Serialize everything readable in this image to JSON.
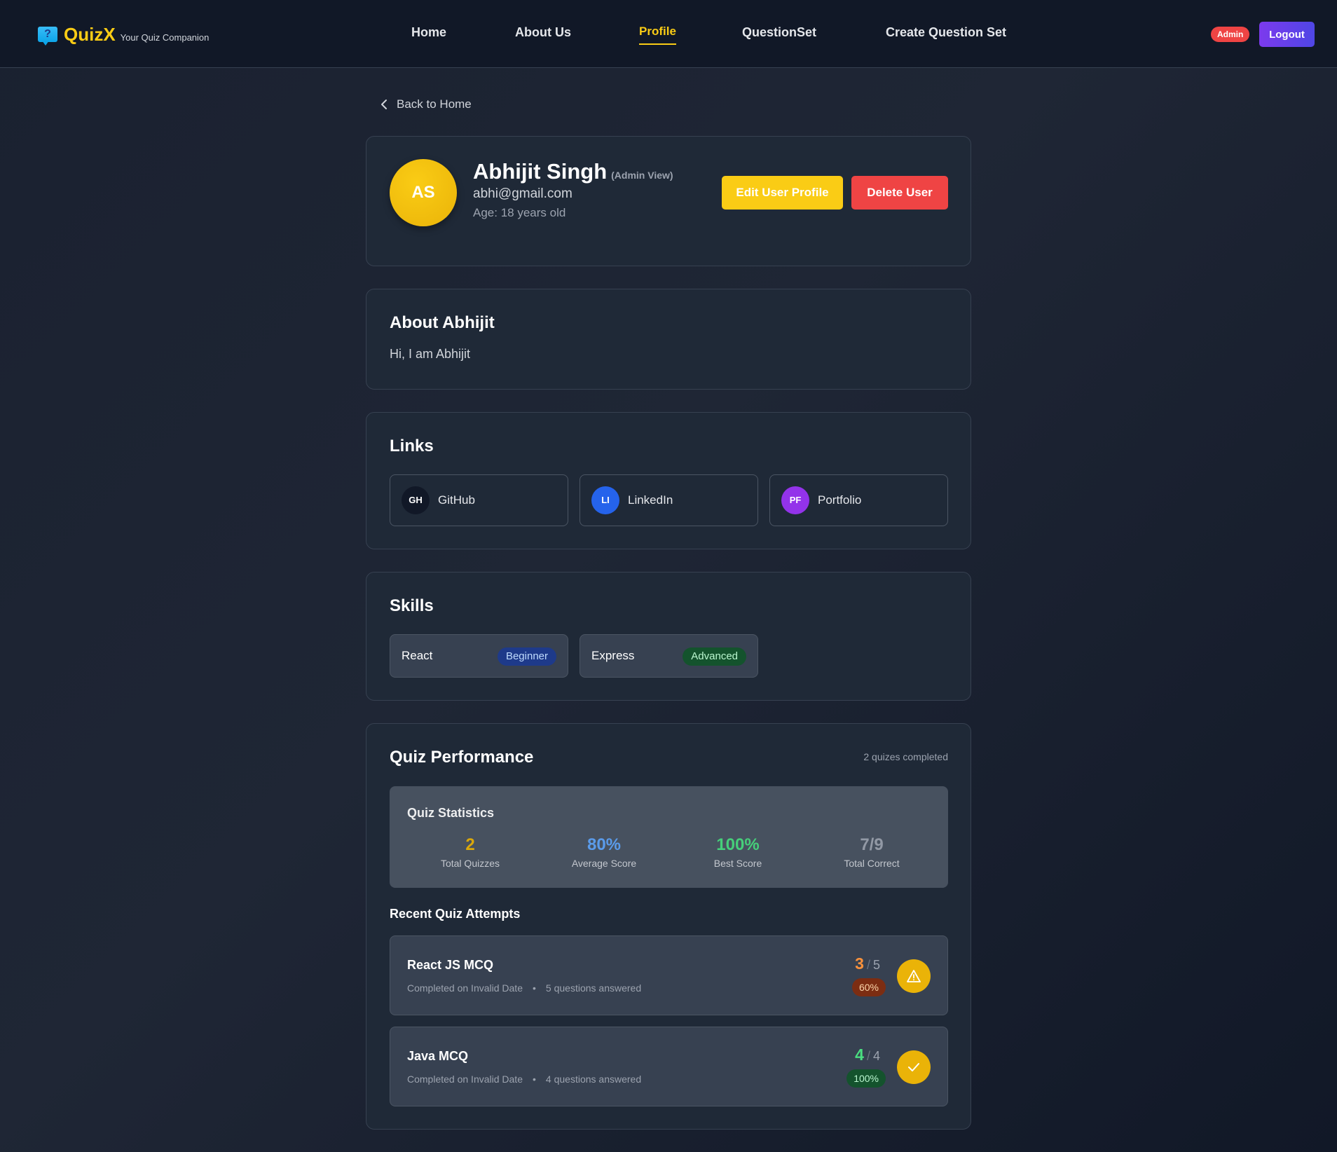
{
  "brand": {
    "name": "QuizX",
    "tagline": "Your Quiz Companion",
    "icon": "question-bubble-icon",
    "accent": "#facc15"
  },
  "nav": {
    "items": [
      {
        "label": "Home"
      },
      {
        "label": "About Us"
      },
      {
        "label": "Profile",
        "active": true
      },
      {
        "label": "QuestionSet"
      },
      {
        "label": "Create Question Set"
      }
    ],
    "role_badge": "Admin",
    "logout_label": "Logout"
  },
  "back_link": {
    "label": "Back to Home",
    "icon": "chevron-left-icon"
  },
  "profile": {
    "initials": "AS",
    "name": "Abhijit Singh",
    "view_note": "(Admin View)",
    "email": "abhi@gmail.com",
    "age": "Age: 18 years old",
    "edit_label": "Edit User Profile",
    "delete_label": "Delete User"
  },
  "about": {
    "title": "About Abhijit",
    "text": "Hi, I am Abhijit"
  },
  "links": {
    "title": "Links",
    "items": [
      {
        "abbr": "GH",
        "label": "GitHub",
        "color": "#111827"
      },
      {
        "abbr": "LI",
        "label": "LinkedIn",
        "color": "#2563eb"
      },
      {
        "abbr": "PF",
        "label": "Portfolio",
        "color": "#9333ea"
      }
    ]
  },
  "skills": {
    "title": "Skills",
    "items": [
      {
        "name": "React",
        "level": "Beginner"
      },
      {
        "name": "Express",
        "level": "Advanced"
      }
    ]
  },
  "performance": {
    "title": "Quiz Performance",
    "completed_note": "2 quizes completed",
    "stats_title": "Quiz Statistics",
    "stats": [
      {
        "value": "2",
        "label": "Total Quizzes",
        "color": "#eab308"
      },
      {
        "value": "80%",
        "label": "Average Score",
        "color": "#60a5fa"
      },
      {
        "value": "100%",
        "label": "Best Score",
        "color": "#4ade80"
      },
      {
        "value": "7/9",
        "label": "Total Correct",
        "color": "#9ca3af"
      }
    ],
    "recent_title": "Recent Quiz Attempts",
    "attempts": [
      {
        "title": "React JS MCQ",
        "completed": "Completed on Invalid Date",
        "bullet": "•",
        "answered": "5 questions answered",
        "score": "3",
        "sep": "/",
        "total": "5",
        "percent": "60%",
        "score_color": "#fb923c",
        "status_icon": "warning-icon"
      },
      {
        "title": "Java MCQ",
        "completed": "Completed on Invalid Date",
        "bullet": "•",
        "answered": "4 questions answered",
        "score": "4",
        "sep": "/",
        "total": "4",
        "percent": "100%",
        "score_color": "#4ade80",
        "status_icon": "check-icon"
      }
    ]
  }
}
